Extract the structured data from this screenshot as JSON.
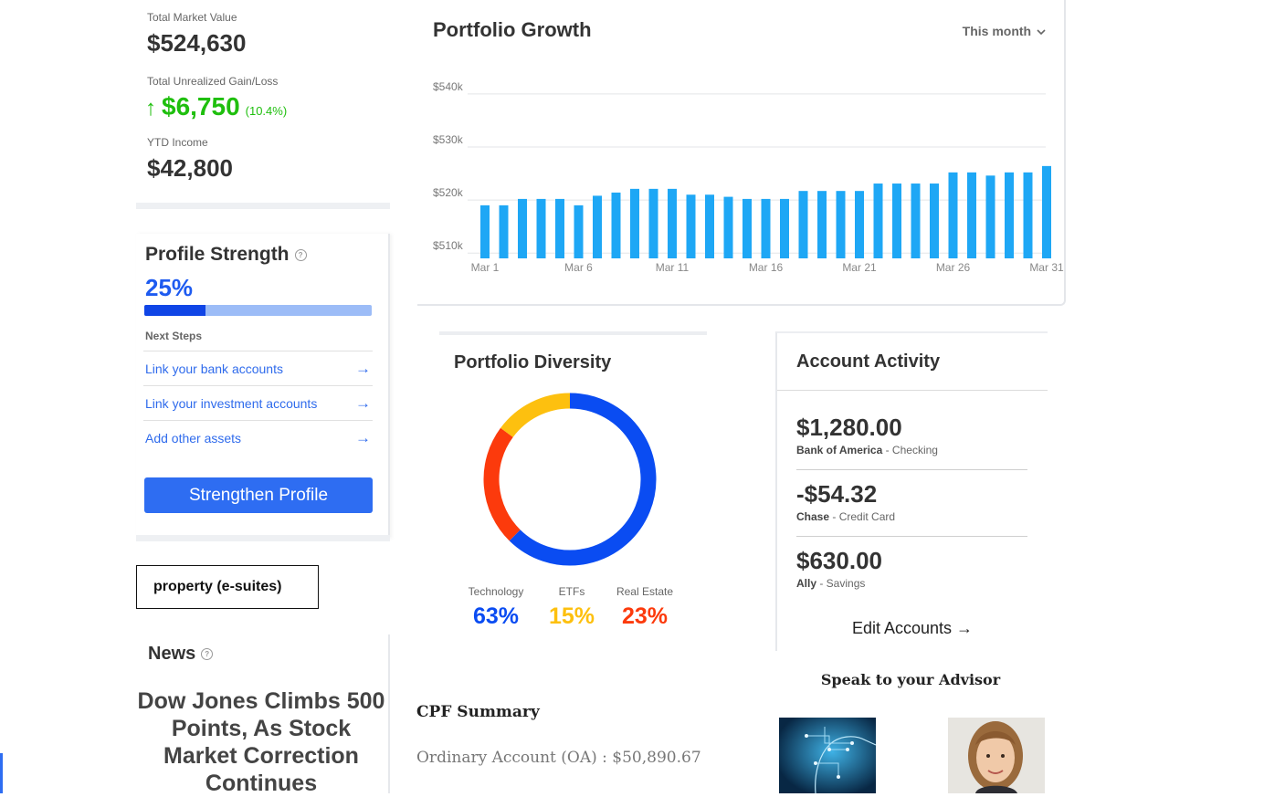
{
  "summary": {
    "market_value_label": "Total Market Value",
    "market_value": "$524,630",
    "gain_label": "Total Unrealized Gain/Loss",
    "gain_arrow": "↑",
    "gain_value": "$6,750",
    "gain_pct": "(10.4%)",
    "ytd_label": "YTD Income",
    "ytd_value": "$42,800"
  },
  "profile": {
    "title": "Profile Strength",
    "help_glyph": "?",
    "percent": "25%",
    "progress_fraction": 0.27,
    "next_steps_label": "Next Steps",
    "steps": [
      {
        "label": "Link your bank accounts",
        "arrow": "→"
      },
      {
        "label": "Link your investment accounts",
        "arrow": "→"
      },
      {
        "label": "Add other assets",
        "arrow": "→"
      }
    ],
    "button_label": "Strengthen Profile"
  },
  "property_box": "property (e-suites)",
  "news": {
    "title": "News",
    "help_glyph": "?",
    "headline": "Dow Jones Climbs 500 Points, As Stock Market Correction Continues"
  },
  "growth": {
    "title": "Portfolio Growth",
    "period": "This month",
    "period_icon": "chevron-down-icon"
  },
  "chart_data": {
    "type": "bar",
    "title": "Portfolio Growth",
    "bar_color": "#1ea7f5",
    "ylim": [
      509000,
      541000
    ],
    "y_ticks": [
      {
        "value": 540000,
        "label": "$540k"
      },
      {
        "value": 530000,
        "label": "$530k"
      },
      {
        "value": 520000,
        "label": "$520k"
      },
      {
        "value": 510000,
        "label": "$510k"
      }
    ],
    "x_ticks": [
      {
        "index": 0,
        "label": "Mar 1"
      },
      {
        "index": 5,
        "label": "Mar 6"
      },
      {
        "index": 10,
        "label": "Mar 11"
      },
      {
        "index": 15,
        "label": "Mar 16"
      },
      {
        "index": 20,
        "label": "Mar 21"
      },
      {
        "index": 25,
        "label": "Mar 26"
      },
      {
        "index": 30,
        "label": "Mar 31"
      }
    ],
    "categories": [
      "Mar 1",
      "Mar 2",
      "Mar 3",
      "Mar 4",
      "Mar 5",
      "Mar 6",
      "Mar 7",
      "Mar 8",
      "Mar 9",
      "Mar 10",
      "Mar 11",
      "Mar 12",
      "Mar 13",
      "Mar 14",
      "Mar 15",
      "Mar 16",
      "Mar 17",
      "Mar 18",
      "Mar 19",
      "Mar 20",
      "Mar 21",
      "Mar 22",
      "Mar 23",
      "Mar 24",
      "Mar 25",
      "Mar 26",
      "Mar 27",
      "Mar 28",
      "Mar 29",
      "Mar 30",
      "Mar 31"
    ],
    "values": [
      519000,
      519000,
      520200,
      520200,
      520200,
      519000,
      520800,
      521400,
      522100,
      522100,
      522100,
      521000,
      521000,
      520600,
      520200,
      520200,
      520200,
      521700,
      521700,
      521700,
      521700,
      523100,
      523100,
      523100,
      523100,
      525200,
      525200,
      524600,
      525200,
      525200,
      526400
    ]
  },
  "diversity": {
    "title": "Portfolio Diversity",
    "slices": [
      {
        "name": "Technology",
        "label": "63%",
        "value": 63,
        "color": "#0a4cf2"
      },
      {
        "name": "ETFs",
        "label": "15%",
        "value": 15,
        "color": "#fdc00f"
      },
      {
        "name": "Real Estate",
        "label": "23%",
        "value": 23,
        "color": "#fc3a0c"
      }
    ]
  },
  "activity": {
    "title": "Account Activity",
    "items": [
      {
        "amount": "$1,280.00",
        "bank": "Bank of America",
        "account": " - Checking"
      },
      {
        "amount": "-$54.32",
        "bank": "Chase",
        "account": " - Credit Card"
      },
      {
        "amount": "$630.00",
        "bank": "Ally",
        "account": " - Savings"
      }
    ],
    "edit_label": "Edit Accounts →"
  },
  "advisor": {
    "title": "Speak to your Advisor"
  },
  "cpf": {
    "title": "CPF Summary",
    "oa_line": "Ordinary Account (OA) : $50,890.67"
  }
}
